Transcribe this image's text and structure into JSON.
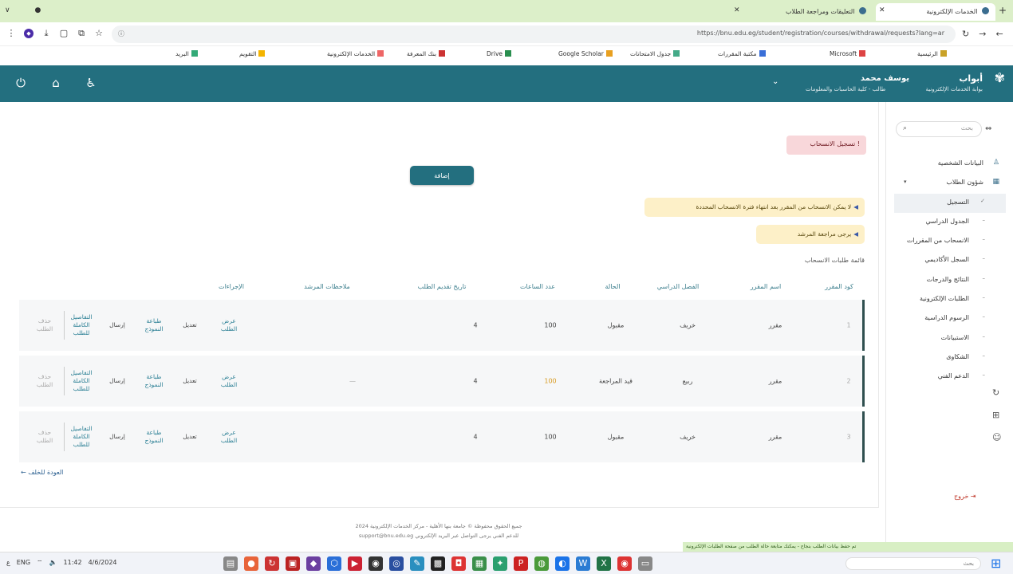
{
  "browser": {
    "tabs": [
      {
        "label": "التعليقات ومراجعة الطلاب",
        "active": false
      },
      {
        "label": "الخدمات الإلكترونية",
        "active": true
      }
    ],
    "new_tab": "+",
    "url": "https://bnu.edu.eg/student/registration/courses/withdrawal/requests?lang=ar",
    "bookmarks": [
      "الرئيسية",
      "Microsoft",
      "مكتبة المقررات",
      "جدول الامتحانات",
      "Google Scholar",
      "Drive",
      "بنك المعرفة",
      "الخدمات الإلكترونية",
      "التقويم",
      "البريد"
    ]
  },
  "header": {
    "brand_name": "أبواب",
    "brand_sub": "بوابة الخدمات الإلكترونية",
    "user_name": "يوسف محمد",
    "user_sub": "طالب - كلية الحاسبات والمعلومات",
    "icons": [
      "power-icon",
      "home-icon",
      "accessibility-icon"
    ]
  },
  "sidebar": {
    "search_placeholder": "بحث",
    "items": [
      {
        "label": "البيانات الشخصية",
        "icon": "person-icon",
        "active": false,
        "sub": false
      },
      {
        "label": "شؤون الطلاب",
        "icon": "grid-icon",
        "active": false,
        "sub": false,
        "caret": "▾"
      },
      {
        "label": "التسجيل",
        "icon": "check-icon",
        "active": true,
        "sub": true
      },
      {
        "label": "الجدول الدراسي",
        "icon": "dash-icon",
        "active": false,
        "sub": true
      },
      {
        "label": "الانسحاب من المقررات",
        "icon": "dash-icon",
        "active": false,
        "sub": true
      },
      {
        "label": "السجل الأكاديمي",
        "icon": "dash-icon",
        "active": false,
        "sub": true
      },
      {
        "label": "النتائج والدرجات",
        "icon": "dash-icon",
        "active": false,
        "sub": true
      },
      {
        "label": "الطلبات الإلكترونية",
        "icon": "dash-icon",
        "active": false,
        "sub": true
      },
      {
        "label": "الرسوم الدراسية",
        "icon": "dash-icon",
        "active": false,
        "sub": true
      },
      {
        "label": "الاستبيانات",
        "icon": "dash-icon",
        "active": false,
        "sub": true
      },
      {
        "label": "الشكاوى",
        "icon": "dash-icon",
        "active": false,
        "sub": true
      },
      {
        "label": "الدعم الفني",
        "icon": "dash-icon",
        "active": false,
        "sub": true
      }
    ],
    "logout": "خروج"
  },
  "main": {
    "alert_red": "! تسجيل الانسحاب",
    "primary_button": "إضافة",
    "alert_yellow_1": "لا يمكن الانسحاب من المقرر بعد انتهاء فترة الانسحاب المحددة",
    "alert_yellow_2": "يرجى مراجعة المرشد",
    "table_caption": "قائمة طلبات الانسحاب",
    "columns": [
      "كود المقرر",
      "اسم المقرر",
      "الفصل الدراسي",
      "الحالة",
      "عدد الساعات",
      "تاريخ تقديم الطلب",
      "ملاحظات المرشد",
      "الإجراءات"
    ],
    "rows": [
      {
        "code": "1",
        "name": "مقرر",
        "term": "خريف",
        "state": "مقبول",
        "hours": "100",
        "date": "4",
        "notes": "",
        "actions": {
          "view": "عرض\nالطلب",
          "edit": "تعديل",
          "print": "طباعة\nالنموذج",
          "send": "إرسال",
          "details": "التفاصيل\nالكاملة\nللطلب",
          "delete": "حذف\nالطلب"
        }
      },
      {
        "code": "2",
        "name": "مقرر",
        "term": "ربيع",
        "state": "قيد المراجعة",
        "hours": "100",
        "date": "4",
        "notes": "—",
        "actions": {
          "view": "عرض\nالطلب",
          "edit": "تعديل",
          "print": "طباعة\nالنموذج",
          "send": "إرسال",
          "details": "التفاصيل\nالكاملة\nللطلب",
          "delete": "حذف\nالطلب"
        }
      },
      {
        "code": "3",
        "name": "مقرر",
        "term": "خريف",
        "state": "مقبول",
        "hours": "100",
        "date": "4",
        "notes": "",
        "actions": {
          "view": "عرض\nالطلب",
          "edit": "تعديل",
          "print": "طباعة\nالنموذج",
          "send": "إرسال",
          "details": "التفاصيل\nالكاملة\nللطلب",
          "delete": "حذف\nالطلب"
        }
      }
    ],
    "back_link": "العودة للخلف ←"
  },
  "footer": {
    "line1": "جميع الحقوق محفوظة © جامعة بنها الأهلية - مركز الخدمات الإلكترونية 2024",
    "line2": "للدعم الفني يرجى التواصل عبر البريد الإلكتروني support@bnu.edu.eg"
  },
  "notification": "تم حفظ بيانات الطلب بنجاح - يمكنك متابعة حالة الطلب من صفحة الطلبات الإلكترونية",
  "taskbar": {
    "tray": [
      "ع",
      "ENG",
      "11:42",
      "4/6/2024"
    ],
    "search_placeholder": "بحث"
  },
  "colors": {
    "header": "#236f7f",
    "accent": "#2a7f94",
    "alert_red_bg": "#f8d7da",
    "alert_yellow_bg": "#fdf0c8",
    "tabbar": "#dcefc9"
  }
}
